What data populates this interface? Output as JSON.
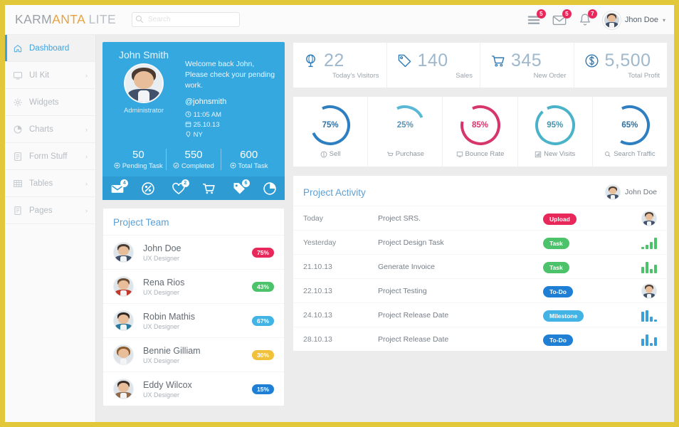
{
  "brand": {
    "part1": "KARM",
    "part2": "ANTA",
    "part3": " ",
    "part4": "LITE"
  },
  "search": {
    "placeholder": "Search",
    "value": ""
  },
  "topbar": {
    "icons": [
      {
        "name": "tasks-icon",
        "badge": "5"
      },
      {
        "name": "mail-icon",
        "badge": "5"
      },
      {
        "name": "bell-icon",
        "badge": "7"
      }
    ],
    "user": "Jhon Doe",
    "caret": "▾"
  },
  "sidebar": {
    "items": [
      {
        "label": "Dashboard",
        "icon": "home-icon",
        "active": true,
        "chevron": ""
      },
      {
        "label": "UI Kit",
        "icon": "monitor-icon",
        "active": false,
        "chevron": "›"
      },
      {
        "label": "Widgets",
        "icon": "widgets-icon",
        "active": false,
        "chevron": ""
      },
      {
        "label": "Charts",
        "icon": "pie-chart-icon",
        "active": false,
        "chevron": "›"
      },
      {
        "label": "Form Stuff",
        "icon": "form-icon",
        "active": false,
        "chevron": "›"
      },
      {
        "label": "Tables",
        "icon": "table-icon",
        "active": false,
        "chevron": "›"
      },
      {
        "label": "Pages",
        "icon": "pages-icon",
        "active": false,
        "chevron": "›"
      }
    ]
  },
  "profile": {
    "name": "John Smith",
    "role": "Administrator",
    "welcome": "Welcome back John, Please check your pending work.",
    "handle": "@johnsmith",
    "time": "11:05 AM",
    "date": "25.10.13",
    "location": "NY",
    "stats": [
      {
        "num": "50",
        "label": "Pending Task"
      },
      {
        "num": "550",
        "label": "Completed"
      },
      {
        "num": "600",
        "label": "Total Task"
      }
    ],
    "icons": [
      {
        "name": "mail-icon",
        "badge": "4"
      },
      {
        "name": "discount-icon",
        "badge": ""
      },
      {
        "name": "heart-icon",
        "badge": "2"
      },
      {
        "name": "cart-icon",
        "badge": ""
      },
      {
        "name": "tag-icon",
        "badge": "6"
      },
      {
        "name": "pie-icon",
        "badge": ""
      }
    ]
  },
  "stats": [
    {
      "num": "22",
      "label": "Today's Visitors",
      "icon": "globe-icon"
    },
    {
      "num": "140",
      "label": "Sales",
      "icon": "tag-icon"
    },
    {
      "num": "345",
      "label": "New Order",
      "icon": "cart-icon"
    },
    {
      "num": "5,500",
      "label": "Total Profit",
      "icon": "dollar-icon"
    }
  ],
  "chart_data": {
    "type": "pie",
    "title": "Performance donut gauges",
    "series": [
      {
        "name": "Sell",
        "value": 75,
        "label": "75%",
        "color": "#2e7fc1",
        "icon": "dollar-icon"
      },
      {
        "name": "Purchase",
        "value": 25,
        "label": "25%",
        "color": "#59b8d6",
        "icon": "cart-icon"
      },
      {
        "name": "Bounce Rate",
        "value": 85,
        "label": "85%",
        "color": "#d6366a",
        "icon": "bounce-icon"
      },
      {
        "name": "New Visits",
        "value": 95,
        "label": "95%",
        "color": "#4bb3c9",
        "icon": "chart-icon"
      },
      {
        "name": "Search Traffic",
        "value": 65,
        "label": "65%",
        "color": "#2e7fc1",
        "icon": "search-icon"
      }
    ],
    "ylim": [
      0,
      100
    ],
    "legend": "below-each"
  },
  "team": {
    "title": "Project Team",
    "members": [
      {
        "name": "John Doe",
        "role": "UX Designer",
        "pct": "75%",
        "color": "#e8275a"
      },
      {
        "name": "Rena Rios",
        "role": "UX Designer",
        "pct": "43%",
        "color": "#4cc36a"
      },
      {
        "name": "Robin Mathis",
        "role": "UX Designer",
        "pct": "67%",
        "color": "#42b3e5"
      },
      {
        "name": "Bennie Gilliam",
        "role": "UX Designer",
        "pct": "30%",
        "color": "#f2c13c"
      },
      {
        "name": "Eddy Wilcox",
        "role": "UX Designer",
        "pct": "15%",
        "color": "#1f7fd4"
      }
    ]
  },
  "activity": {
    "title": "Project Activity",
    "owner": "John Doe",
    "rows": [
      {
        "date": "Today",
        "desc": "Project SRS.",
        "badge": "Upload",
        "badge_color": "#e8275a",
        "end": "avatar",
        "spark": []
      },
      {
        "date": "Yesterday",
        "desc": "Project Design Task",
        "badge": "Task",
        "badge_color": "#4cc36a",
        "end": "spark",
        "spark_color": "#4cc36a",
        "spark": [
          3,
          6,
          10,
          16
        ]
      },
      {
        "date": "21.10.13",
        "desc": "Generate Invoice",
        "badge": "Task",
        "badge_color": "#4cc36a",
        "end": "spark",
        "spark_color": "#4cc36a",
        "spark": [
          9,
          16,
          6,
          12
        ]
      },
      {
        "date": "22.10.13",
        "desc": "Project Testing",
        "badge": "To-Do",
        "badge_color": "#1f7fd4",
        "end": "avatar",
        "spark": []
      },
      {
        "date": "24.10.13",
        "desc": "Project Release Date",
        "badge": "Milestone",
        "badge_color": "#42b3e5",
        "end": "spark",
        "spark_color": "#3b9fd8",
        "spark": [
          14,
          16,
          7,
          3
        ]
      },
      {
        "date": "28.10.13",
        "desc": "Project Release Date",
        "badge": "To-Do",
        "badge_color": "#1f7fd4",
        "end": "spark",
        "spark_color": "#3b9fd8",
        "spark": [
          10,
          16,
          4,
          12
        ]
      }
    ]
  }
}
